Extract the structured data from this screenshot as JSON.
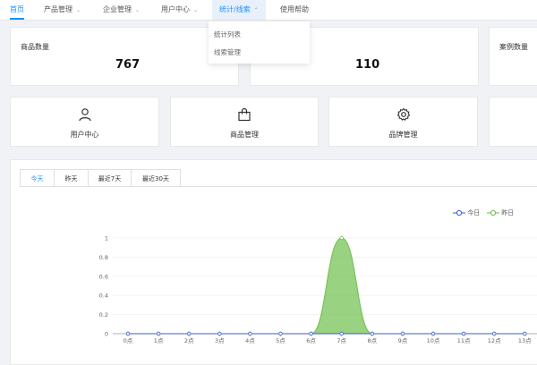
{
  "nav": {
    "items": [
      {
        "label": "首页",
        "has_dropdown": false
      },
      {
        "label": "产品管理",
        "has_dropdown": true
      },
      {
        "label": "企业管理",
        "has_dropdown": true
      },
      {
        "label": "用户中心",
        "has_dropdown": true
      },
      {
        "label": "统计/线索",
        "has_dropdown": true
      },
      {
        "label": "使用帮助",
        "has_dropdown": false
      }
    ],
    "chevron_icon": "chevron-down-icon",
    "chevron_up_icon": "chevron-up-icon",
    "active_color": "#1890ff",
    "dropdown": [
      "统计列表",
      "线索管理"
    ]
  },
  "stats": [
    {
      "label": "商品数量",
      "value": "767"
    },
    {
      "label": "",
      "value": "110"
    },
    {
      "label": "案例数量",
      "value": ""
    }
  ],
  "quick_actions": [
    {
      "label": "用户中心",
      "icon": "user-icon"
    },
    {
      "label": "商品管理",
      "icon": "shopping-bag-icon"
    },
    {
      "label": "品牌管理",
      "icon": "gear-icon"
    }
  ],
  "tabs": [
    "今天",
    "昨天",
    "最近7天",
    "最近30天"
  ],
  "chart_data": {
    "type": "area",
    "x": [
      "0点",
      "1点",
      "2点",
      "3点",
      "4点",
      "5点",
      "6点",
      "7点",
      "8点",
      "9点",
      "10点",
      "11点",
      "12点",
      "13点"
    ],
    "y_ticks": [
      "0",
      "0.2",
      "0.4",
      "0.6",
      "0.8",
      "1"
    ],
    "ylim": [
      0,
      1
    ],
    "series": [
      {
        "name": "今日",
        "color": "#3b5fc4",
        "values": [
          0,
          0,
          0,
          0,
          0,
          0,
          0,
          0,
          0,
          0,
          0,
          0,
          0,
          0
        ]
      },
      {
        "name": "昨日",
        "color": "#6dbf4c",
        "values": [
          0,
          0,
          0,
          0,
          0,
          0,
          0,
          1,
          0,
          0,
          0,
          0,
          0,
          0
        ]
      }
    ],
    "legend_position": "top-right",
    "grid": true
  }
}
